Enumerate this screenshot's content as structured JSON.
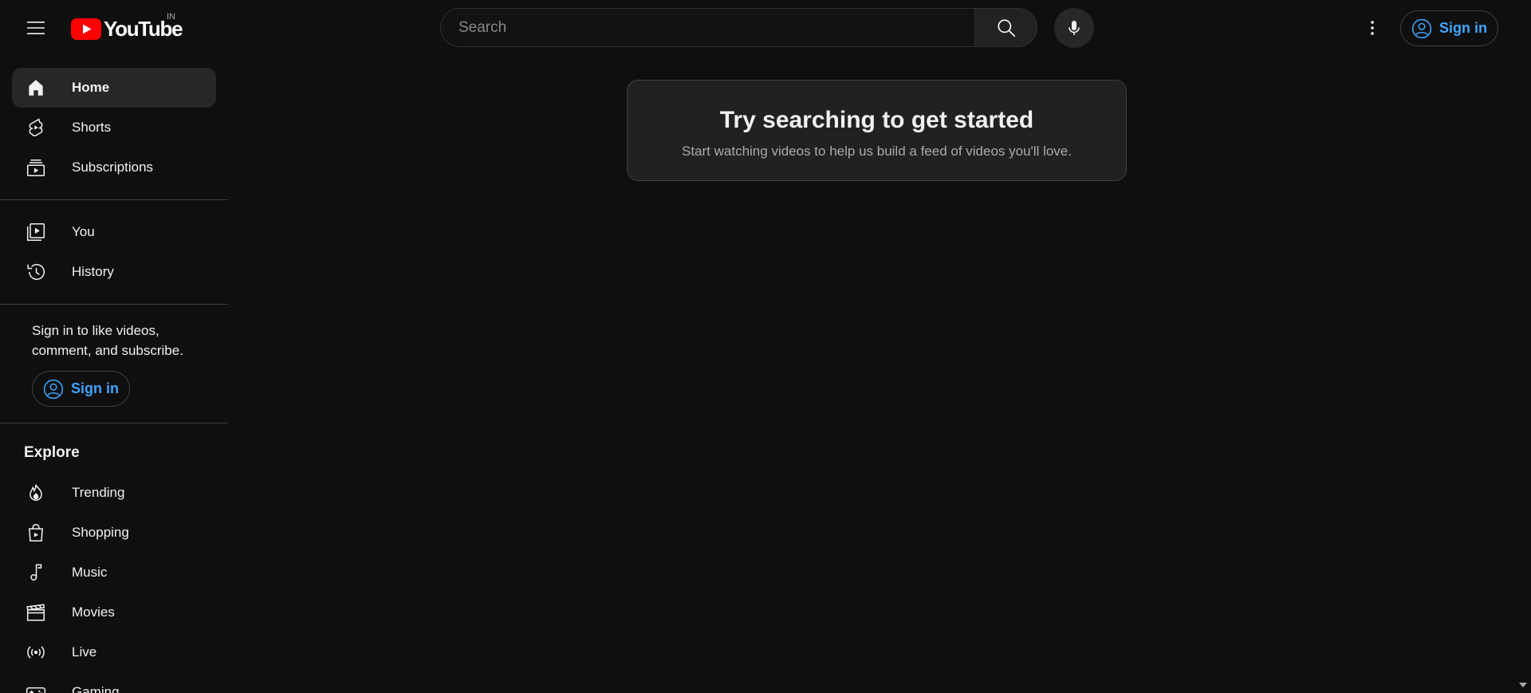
{
  "masthead": {
    "logo_text": "YouTube",
    "country_code": "IN",
    "search_placeholder": "Search",
    "signin_label": "Sign in"
  },
  "sidebar": {
    "primary": [
      {
        "label": "Home",
        "icon": "home-icon",
        "active": true
      },
      {
        "label": "Shorts",
        "icon": "shorts-icon"
      },
      {
        "label": "Subscriptions",
        "icon": "subscriptions-icon"
      }
    ],
    "library": [
      {
        "label": "You",
        "icon": "you-icon"
      },
      {
        "label": "History",
        "icon": "history-icon"
      }
    ],
    "signin_prompt": "Sign in to like videos, comment, and subscribe.",
    "signin_label": "Sign in",
    "explore_title": "Explore",
    "explore": [
      {
        "label": "Trending",
        "icon": "trending-icon"
      },
      {
        "label": "Shopping",
        "icon": "shopping-icon"
      },
      {
        "label": "Music",
        "icon": "music-icon"
      },
      {
        "label": "Movies",
        "icon": "movies-icon"
      },
      {
        "label": "Live",
        "icon": "live-icon"
      },
      {
        "label": "Gaming",
        "icon": "gaming-icon"
      }
    ]
  },
  "main": {
    "empty_title": "Try searching to get started",
    "empty_subtitle": "Start watching videos to help us build a feed of videos you'll love."
  },
  "colors": {
    "background": "#0f0f0f",
    "accent_blue": "#3ea6ff",
    "logo_red": "#ff0000",
    "active_item": "#272727"
  }
}
